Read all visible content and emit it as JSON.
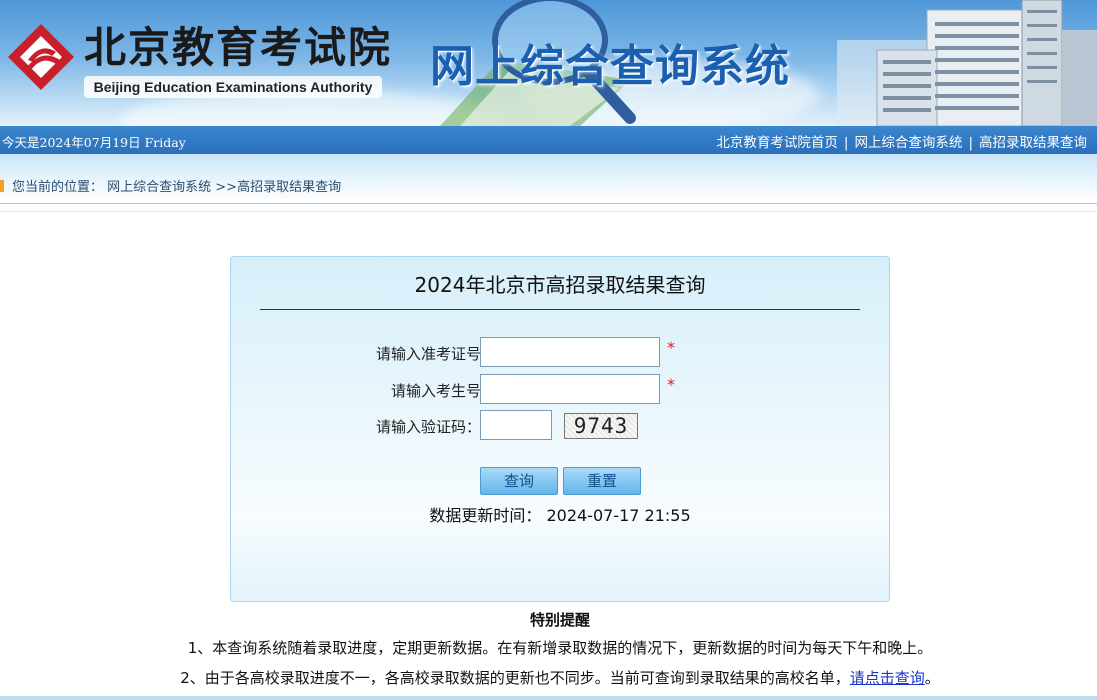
{
  "banner": {
    "org_name": "北京教育考试院",
    "org_name_en": "Beijing Education Examinations Authority",
    "system_name": "网上综合查询系统"
  },
  "top_bar": {
    "today": "今天是2024年07月19日 Friday",
    "links": [
      "北京教育考试院首页",
      "网上综合查询系统",
      "高招录取结果查询"
    ],
    "separator": "|"
  },
  "breadcrumb": {
    "prefix": "您当前的位置：",
    "path": "网上综合查询系统 >>高招录取结果查询"
  },
  "form": {
    "title": "2024年北京市高招录取结果查询",
    "fields": [
      {
        "label": "请输入准考证号",
        "value": "",
        "required": true
      },
      {
        "label": "请输入考生号",
        "value": "",
        "required": true
      },
      {
        "label": "请输入验证码：",
        "value": "",
        "required": false
      }
    ],
    "required_mark": "*",
    "captcha_text": "9743",
    "buttons": {
      "submit": "查询",
      "reset": "重置"
    },
    "update_label": "数据更新时间：",
    "update_time": "2024-07-17 21:55"
  },
  "notice": {
    "title": "特别提醒",
    "item1": "1、本查询系统随着录取进度，定期更新数据。在有新增录取数据的情况下，更新数据的时间为每天下午和晚上。",
    "item2_text": "2、由于各高校录取进度不一，各高校录取数据的更新也不同步。当前可查询到录取结果的高校名单，",
    "item2_link": "请点击查询",
    "item2_end": "。"
  },
  "colors": {
    "top_strip": "#2a70b9",
    "required": "#e02020",
    "link": "#1a35c8",
    "button": "#62b5ea"
  }
}
